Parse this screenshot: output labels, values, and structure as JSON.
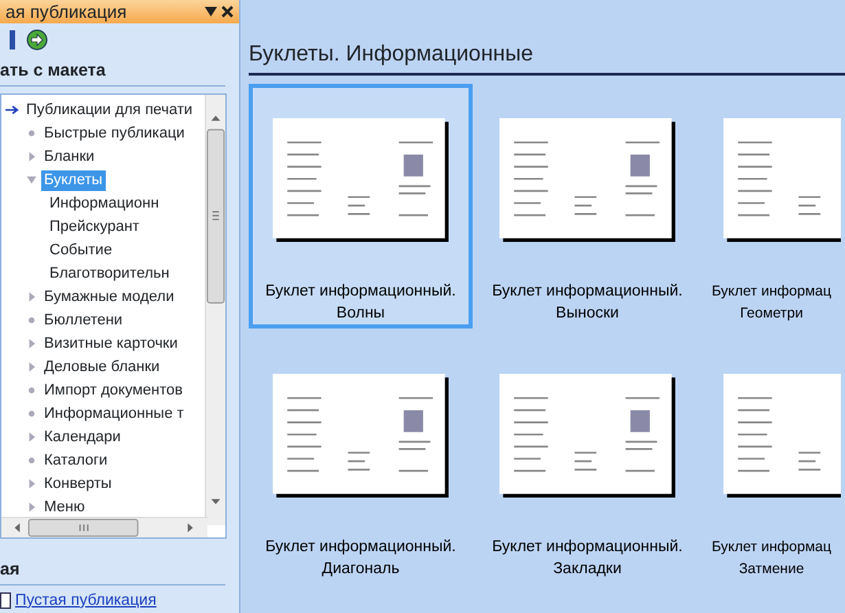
{
  "task_pane": {
    "title": "ая публикация",
    "section_template": "ать с макета",
    "tree": [
      {
        "label": "Публикации для печати",
        "kind": "root",
        "selected": false,
        "children": [
          {
            "label": "Быстрые публикаци",
            "kind": "leaf",
            "selected": false
          },
          {
            "label": "Бланки",
            "kind": "collapsed",
            "selected": false
          },
          {
            "label": "Буклеты",
            "kind": "expanded",
            "selected": true,
            "children": [
              {
                "label": "Информационн",
                "kind": "plain",
                "selected": false
              },
              {
                "label": "Прейскурант",
                "kind": "plain",
                "selected": false
              },
              {
                "label": "Событие",
                "kind": "plain",
                "selected": false
              },
              {
                "label": "Благотворительн",
                "kind": "plain",
                "selected": false
              }
            ]
          },
          {
            "label": "Бумажные модели",
            "kind": "collapsed",
            "selected": false
          },
          {
            "label": "Бюллетени",
            "kind": "leaf",
            "selected": false
          },
          {
            "label": "Визитные карточки",
            "kind": "collapsed",
            "selected": false
          },
          {
            "label": "Деловые бланки",
            "kind": "collapsed",
            "selected": false
          },
          {
            "label": "Импорт документов",
            "kind": "leaf",
            "selected": false
          },
          {
            "label": "Информационные т",
            "kind": "leaf",
            "selected": false
          },
          {
            "label": "Календари",
            "kind": "collapsed",
            "selected": false
          },
          {
            "label": "Каталоги",
            "kind": "leaf",
            "selected": false
          },
          {
            "label": "Конверты",
            "kind": "collapsed",
            "selected": false
          },
          {
            "label": "Меню",
            "kind": "collapsed",
            "selected": false
          }
        ]
      }
    ],
    "section_new": "ая",
    "blank_link": "Пустая публикация"
  },
  "gallery": {
    "heading": "Буклеты. Информационные",
    "templates": [
      {
        "title": "Буклет информационный.",
        "subtitle": "Волны",
        "selected": true
      },
      {
        "title": "Буклет информационный.",
        "subtitle": "Выноски",
        "selected": false
      },
      {
        "title": "Буклет информац",
        "subtitle": "Геометри",
        "selected": false
      },
      {
        "title": "Буклет информационный.",
        "subtitle": "Диагональ",
        "selected": false
      },
      {
        "title": "Буклет информационный.",
        "subtitle": "Закладки",
        "selected": false
      },
      {
        "title": "Буклет информац",
        "subtitle": "Затмение",
        "selected": false
      }
    ]
  }
}
